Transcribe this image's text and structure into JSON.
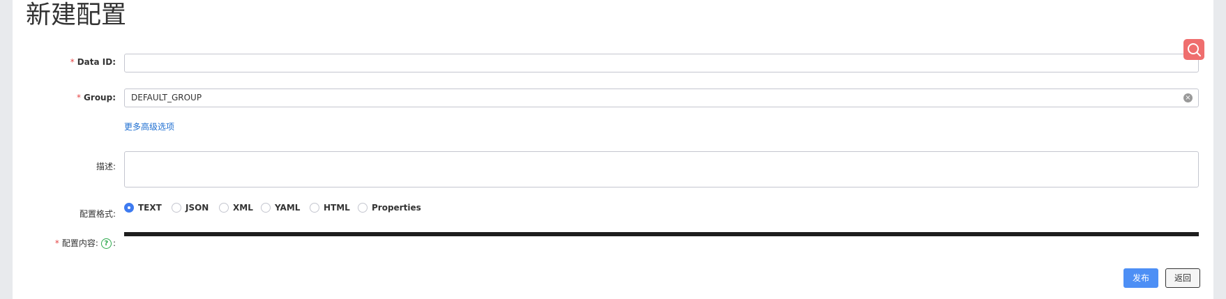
{
  "page": {
    "title": "新建配置"
  },
  "form": {
    "data_id": {
      "label": "Data ID:",
      "value": "",
      "required": true
    },
    "group": {
      "label": "Group:",
      "value": "DEFAULT_GROUP",
      "required": true
    },
    "advanced_link": "更多高级选项",
    "description": {
      "label": "描述:",
      "value": ""
    },
    "format": {
      "label": "配置格式:",
      "options": [
        "TEXT",
        "JSON",
        "XML",
        "YAML",
        "HTML",
        "Properties"
      ],
      "selected": "TEXT"
    },
    "content": {
      "label": "配置内容:",
      "suffix": ":",
      "required": true
    }
  },
  "actions": {
    "publish": "发布",
    "back": "返回"
  },
  "icons": {
    "search": "search-icon",
    "clear": "clear-circle-icon",
    "help": "question-circle-icon"
  },
  "colors": {
    "required": "#e54545",
    "primary": "#4d8ff5",
    "link": "#1f6fd1",
    "search_button": "#ef6e6e",
    "help": "#2aa84a",
    "editor": "#1e1e1e"
  }
}
